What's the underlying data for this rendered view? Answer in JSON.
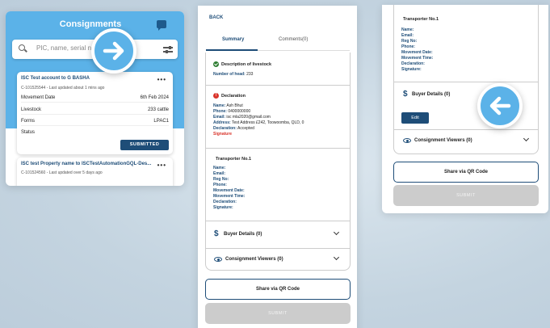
{
  "panel1": {
    "title": "Consignments",
    "search_placeholder": "PIC, name, serial number",
    "cards": [
      {
        "title": "ISC Test account to G BASHA",
        "meta": "C-101525544 - Last updated about 1 mins ago",
        "rows": [
          {
            "label": "Movement Date",
            "value": "6th Feb 2024"
          },
          {
            "label": "Livestock",
            "value": "233 cattle"
          },
          {
            "label": "Forms",
            "value": "LPAC1"
          },
          {
            "label": "Status",
            "value": ""
          }
        ],
        "status_button": "SUBMITTED"
      },
      {
        "title": "ISC test Property name to ISCTestAutomationGQL-Des...",
        "meta": "C-101524560 - Last updated over 5 days ago"
      }
    ]
  },
  "panel2": {
    "back": "BACK",
    "tabs": [
      "Summary",
      "Comments(0)"
    ],
    "livestock": {
      "title": "Description of livestock",
      "head_label": "Number of head:",
      "head_value": "233"
    },
    "declaration": {
      "title": "Declaration",
      "name_label": "Name:",
      "name_value": "Ash Bhut",
      "phone_label": "Phone:",
      "phone_value": "0400000000",
      "email_label": "Email:",
      "email_value": "isc mla2020@gmail.com",
      "address_label": "Address:",
      "address_value": "Test Address £242, Toowoomba, QLD, 0",
      "decl_label": "Declaration:",
      "decl_value": "Accepted",
      "signature": "Signature"
    },
    "transporter": {
      "title": "Transporter No.1",
      "fields": [
        "Name:",
        "Email:",
        "Reg No:",
        "Phone:",
        "Movement Date:",
        "Movement Time:",
        "Declaration:",
        "Signature:"
      ]
    },
    "buyer": "Buyer Details (0)",
    "viewers": "Consignment Viewers (0)",
    "share_button": "Share via QR Code",
    "submit_button": "SUBMIT"
  },
  "panel3": {
    "transporter_title": "Transporter No.1",
    "fields": [
      "Name:",
      "Email:",
      "Reg No:",
      "Phone:",
      "Movement Date:",
      "Movement Time:",
      "Declaration:",
      "Signature:"
    ],
    "buyer": "Buyer Details (0)",
    "edit_button": "Edit",
    "viewers": "Consignment Viewers (0)",
    "share_button": "Share via QR Code",
    "submit_button": "SUBMIT"
  }
}
